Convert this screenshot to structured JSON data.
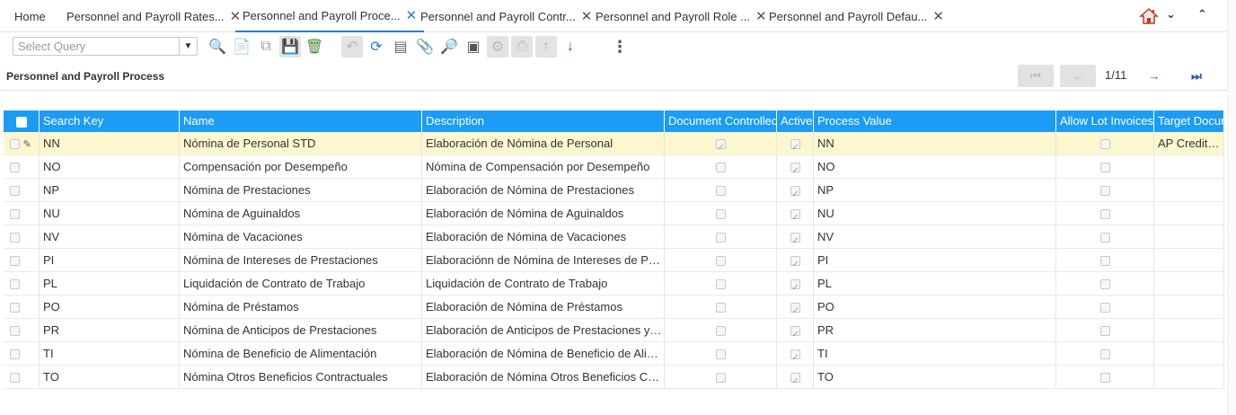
{
  "tabs": [
    {
      "label": "Home",
      "closable": false
    },
    {
      "label": "Personnel and Payroll Rates...",
      "closable": true
    },
    {
      "label": "Personnel and Payroll Proce...",
      "closable": true,
      "active": true
    },
    {
      "label": "Personnel and Payroll Contr...",
      "closable": true
    },
    {
      "label": "Personnel and Payroll Role ...",
      "closable": true
    },
    {
      "label": "Personnel and Payroll Defau...",
      "closable": true
    }
  ],
  "toolbar": {
    "query_placeholder": "Select Query",
    "more_label": "⋮"
  },
  "window_title": "Personnel and Payroll Process",
  "pager": {
    "text": "1/11"
  },
  "columns": [
    "Search Key",
    "Name",
    "Description",
    "Document Controlled",
    "Active",
    "Process Value",
    "Allow Lot Invoices",
    "Target Docum"
  ],
  "rows": [
    {
      "key": "NN",
      "name": "Nómina de Personal STD",
      "desc": "Elaboración de Nómina de Personal",
      "doc": true,
      "active": true,
      "value": "NN",
      "lot": false,
      "target": "AP CreditMe"
    },
    {
      "key": "NO",
      "name": "Compensación por Desempeño",
      "desc": "Nómina de Compensación por Desempeño",
      "doc": false,
      "active": true,
      "value": "NO",
      "lot": false,
      "target": ""
    },
    {
      "key": "NP",
      "name": "Nómina de Prestaciones",
      "desc": "Elaboración de Nómina de Prestaciones",
      "doc": false,
      "active": true,
      "value": "NP",
      "lot": false,
      "target": ""
    },
    {
      "key": "NU",
      "name": "Nómina de Aguinaldos",
      "desc": "Elaboración de Nómina de Aguinaldos",
      "doc": false,
      "active": true,
      "value": "NU",
      "lot": false,
      "target": ""
    },
    {
      "key": "NV",
      "name": "Nómina de Vacaciones",
      "desc": "Elaboración de Nómina de Vacaciones",
      "doc": false,
      "active": true,
      "value": "NV",
      "lot": false,
      "target": ""
    },
    {
      "key": "PI",
      "name": "Nómina de Intereses de Prestaciones",
      "desc": "Elaboraciónn de Nómina de Intereses de Pres...",
      "doc": false,
      "active": true,
      "value": "PI",
      "lot": false,
      "target": ""
    },
    {
      "key": "PL",
      "name": "Liquidación de Contrato de Trabajo",
      "desc": "Liquidación de Contrato de Trabajo",
      "doc": false,
      "active": true,
      "value": "PL",
      "lot": false,
      "target": ""
    },
    {
      "key": "PO",
      "name": "Nómina de Préstamos",
      "desc": "Elaboración de Nómina de Préstamos",
      "doc": false,
      "active": true,
      "value": "PO",
      "lot": false,
      "target": ""
    },
    {
      "key": "PR",
      "name": "Nómina de Anticipos de Prestaciones",
      "desc": "Elaboración de Anticipos de Prestaciones y R...",
      "doc": false,
      "active": true,
      "value": "PR",
      "lot": false,
      "target": ""
    },
    {
      "key": "TI",
      "name": "Nómina de Beneficio de Alimentación",
      "desc": "Elaboración de Nómina de Beneficio de Alime...",
      "doc": false,
      "active": true,
      "value": "TI",
      "lot": false,
      "target": ""
    },
    {
      "key": "TO",
      "name": "Nómina Otros Beneficios Contractuales",
      "desc": "Elaboración de Nómina Otros Beneficios Cont...",
      "doc": false,
      "active": true,
      "value": "TO",
      "lot": false,
      "target": ""
    }
  ],
  "colors": {
    "accent": "#1c9cf4",
    "selected_row": "#fcf7cf",
    "active_tab": "#2b7bd0"
  }
}
